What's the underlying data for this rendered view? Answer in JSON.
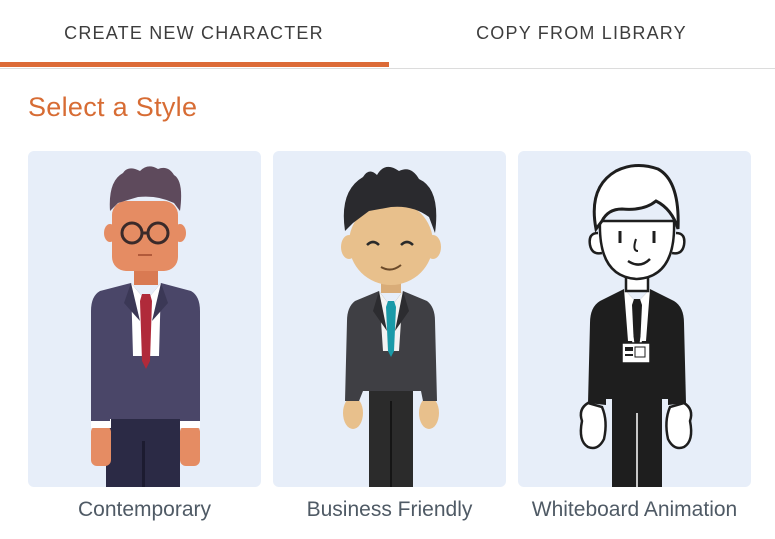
{
  "tabs": {
    "create_label": "CREATE NEW CHARACTER",
    "copy_label": "COPY FROM LIBRARY",
    "active": "create"
  },
  "heading": "Select a Style",
  "styles": [
    {
      "label": "Contemporary",
      "icon": "contemporary-character-icon"
    },
    {
      "label": "Business Friendly",
      "icon": "business-friendly-character-icon"
    },
    {
      "label": "Whiteboard Animation",
      "icon": "whiteboard-character-icon"
    }
  ],
  "colors": {
    "accent": "#dc6a36",
    "card_bg": "#e7eef9"
  }
}
